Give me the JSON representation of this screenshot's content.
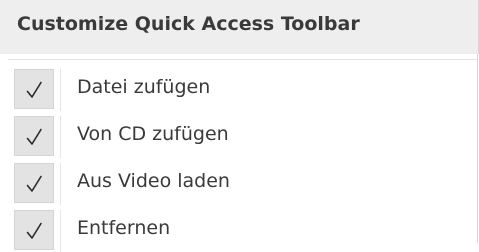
{
  "menu": {
    "title": "Customize Quick Access Toolbar",
    "items": [
      {
        "label": "Datei zufügen",
        "checked": true,
        "icon": "checkmark-icon"
      },
      {
        "label": "Von CD zufügen",
        "checked": true,
        "icon": "checkmark-icon"
      },
      {
        "label": "Aus Video laden",
        "checked": true,
        "icon": "checkmark-icon"
      },
      {
        "label": "Entfernen",
        "checked": true,
        "icon": "checkmark-icon"
      }
    ]
  },
  "colors": {
    "header_background": "#eeeeee",
    "check_background": "#e3e3e3",
    "text": "#3a3a3a"
  }
}
